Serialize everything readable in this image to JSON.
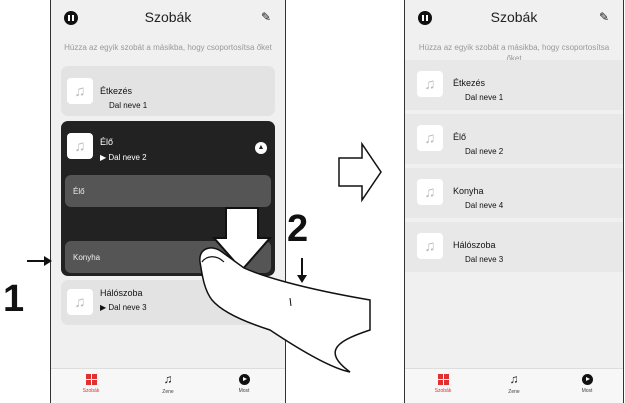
{
  "app": {
    "title": "Szobák"
  },
  "hint": "Húzza az egyik szobát a másikba, hogy csoportosítsa őket",
  "left": {
    "rooms": [
      {
        "name": "Étkezés",
        "song": "Dal neve 1"
      },
      {
        "name": "Élő",
        "song": "Dal neve 2"
      },
      {
        "name": "Hálószoba",
        "song": "Dal neve 3"
      }
    ],
    "group_rows": [
      "Élő",
      "Konyha"
    ]
  },
  "right": {
    "rooms": [
      {
        "name": "Étkezés",
        "song": "Dal neve 1"
      },
      {
        "name": "Élő",
        "song": "Dal neve 2"
      },
      {
        "name": "Konyha",
        "song": "Dal neve 4"
      },
      {
        "name": "Hálószoba",
        "song": "Dal neve 3"
      }
    ]
  },
  "tabs": [
    {
      "label": "Szobák",
      "icon": "rooms-grid-icon"
    },
    {
      "label": "Zene",
      "icon": "music-note-icon"
    },
    {
      "label": "Most",
      "icon": "now-playing-icon"
    }
  ],
  "callouts": {
    "step1": "1",
    "step2": "2"
  },
  "colors": {
    "accent": "#e03030",
    "dark_card": "#222222",
    "background": "#f0f0f0"
  }
}
